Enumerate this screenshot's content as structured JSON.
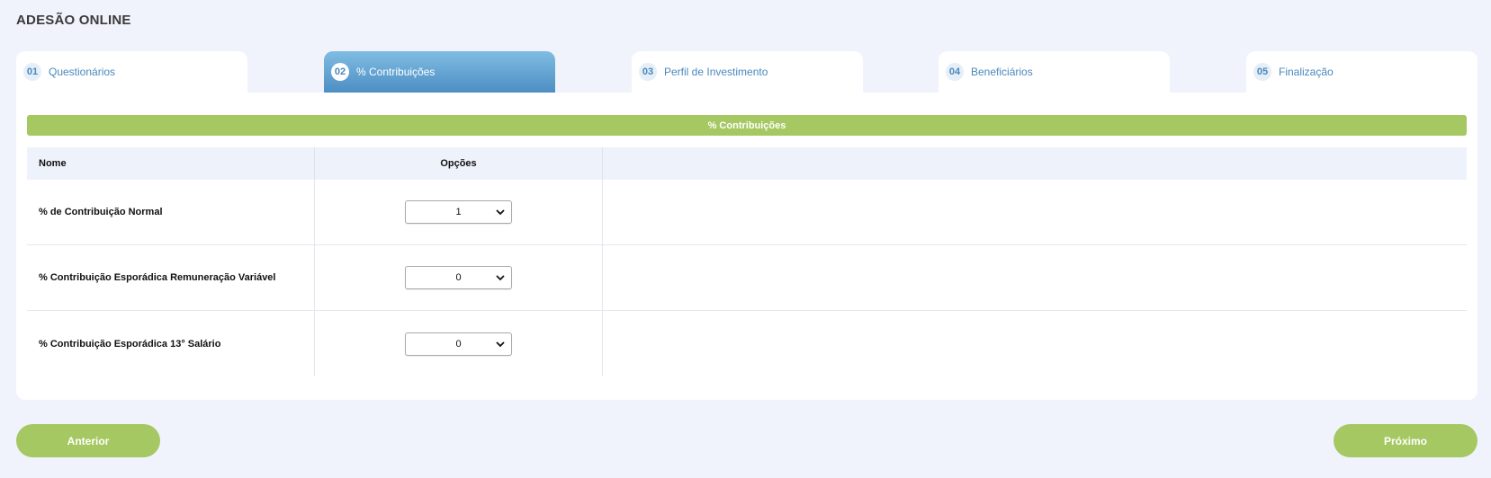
{
  "page": {
    "title": "ADESÃO ONLINE"
  },
  "tabs": [
    {
      "num": "01",
      "label": "Questionários",
      "active": false
    },
    {
      "num": "02",
      "label": "% Contribuições",
      "active": true
    },
    {
      "num": "03",
      "label": "Perfil de Investimento",
      "active": false
    },
    {
      "num": "04",
      "label": "Beneficiários",
      "active": false
    },
    {
      "num": "05",
      "label": "Finalização",
      "active": false
    }
  ],
  "section": {
    "title": "% Contribuições"
  },
  "table": {
    "headers": {
      "name": "Nome",
      "options": "Opções"
    },
    "rows": [
      {
        "name": "% de Contribuição Normal",
        "value": "1"
      },
      {
        "name": "% Contribuição Esporádica Remuneração Variável",
        "value": "0"
      },
      {
        "name": "% Contribuição Esporádica 13° Salário",
        "value": "0"
      }
    ]
  },
  "buttons": {
    "previous": "Anterior",
    "next": "Próximo"
  },
  "colors": {
    "accent_green": "#a5c862",
    "accent_blue": "#4a88bd",
    "background": "#f0f3fc"
  },
  "icons": {
    "select_arrow": "chevron-down-icon"
  }
}
